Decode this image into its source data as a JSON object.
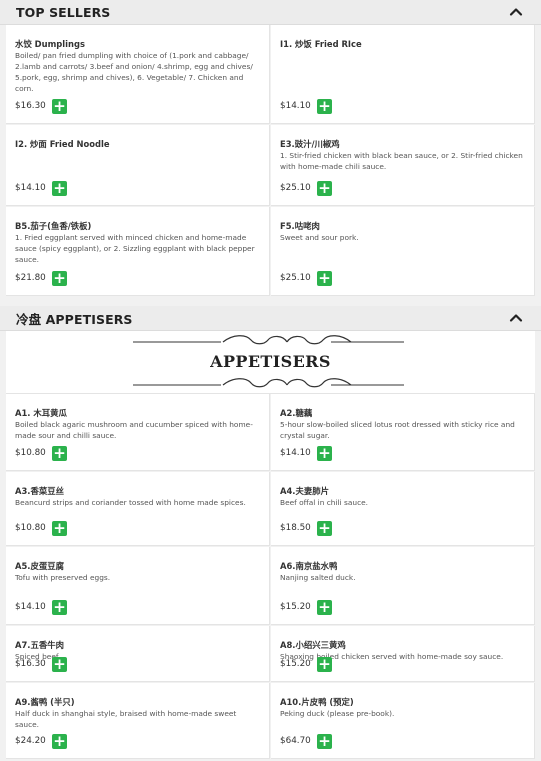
{
  "sections": {
    "top_sellers": {
      "title": "TOP SELLERS"
    },
    "appetisers": {
      "title": "冷盘 APPETISERS",
      "banner_title": "APPETISERS"
    }
  },
  "top_sellers_items": [
    {
      "name": "水饺 Dumplings",
      "desc": "Boiled/ pan fried dumpling with choice of (1.pork and cabbage/ 2.lamb and carrots/ 3.beef and onion/ 4.shrimp, egg and chives/ 5.pork, egg, shrimp and chives), 6. Vegetable/ 7. Chicken and corn.",
      "price": "$16.30"
    },
    {
      "name": "I1. 炒饭 Fried RIce",
      "desc": "",
      "price": "$14.10"
    },
    {
      "name": "I2. 炒面 Fried Noodle",
      "desc": "",
      "price": "$14.10"
    },
    {
      "name": "E3.豉汁/川椒鸡",
      "desc": "1. Stir-fried chicken with black bean sauce, or 2. Stir-fried chicken with home-made chili sauce.",
      "price": "$25.10"
    },
    {
      "name": "B5.茄子(鱼香/铁板)",
      "desc": "1. Fried eggplant served with minced chicken and home-made sauce (spicy eggplant), or 2. Sizzling eggplant with black pepper sauce.",
      "price": "$21.80"
    },
    {
      "name": "F5.咕咾肉",
      "desc": "Sweet and sour pork.",
      "price": "$25.10"
    }
  ],
  "appetiser_items": [
    {
      "name": "A1. 木耳黄瓜",
      "desc": "Boiled black agaric mushroom and cucumber spiced with home-made sour and chilli sauce.",
      "price": "$10.80"
    },
    {
      "name": "A2.糖藕",
      "desc": "5-hour slow-boiled sliced lotus root dressed with sticky rice and crystal sugar.",
      "price": "$14.10"
    },
    {
      "name": "A3.香菜豆丝",
      "desc": "Beancurd strips and coriander tossed with home made spices.",
      "price": "$10.80"
    },
    {
      "name": "A4.夫妻肺片",
      "desc": "Beef offal in chili sauce.",
      "price": "$18.50"
    },
    {
      "name": "A5.皮蛋豆腐",
      "desc": "Tofu with preserved eggs.",
      "price": "$14.10"
    },
    {
      "name": "A6.南京盐水鸭",
      "desc": "Nanjing salted duck.",
      "price": "$15.20"
    },
    {
      "name": "A7.五香牛肉",
      "desc": "Spiced beef.",
      "price": "$16.30"
    },
    {
      "name": "A8.小绍兴三黄鸡",
      "desc": "Shaoxing boiled chicken served with home-made soy sauce.",
      "price": "$15.20"
    },
    {
      "name": "A9.酱鸭 (半只)",
      "desc": "Half duck in shanghai style, braised with home-made sweet sauce.",
      "price": "$24.20"
    },
    {
      "name": "A10.片皮鸭 (预定)",
      "desc": "Peking duck (please pre-book).",
      "price": "$64.70"
    }
  ],
  "add_button": {
    "symbol": "+"
  },
  "colors": {
    "accent_green": "#2bb24c",
    "header_bg": "#ececec"
  },
  "icons": {
    "collapse": "chevron-up-icon"
  }
}
